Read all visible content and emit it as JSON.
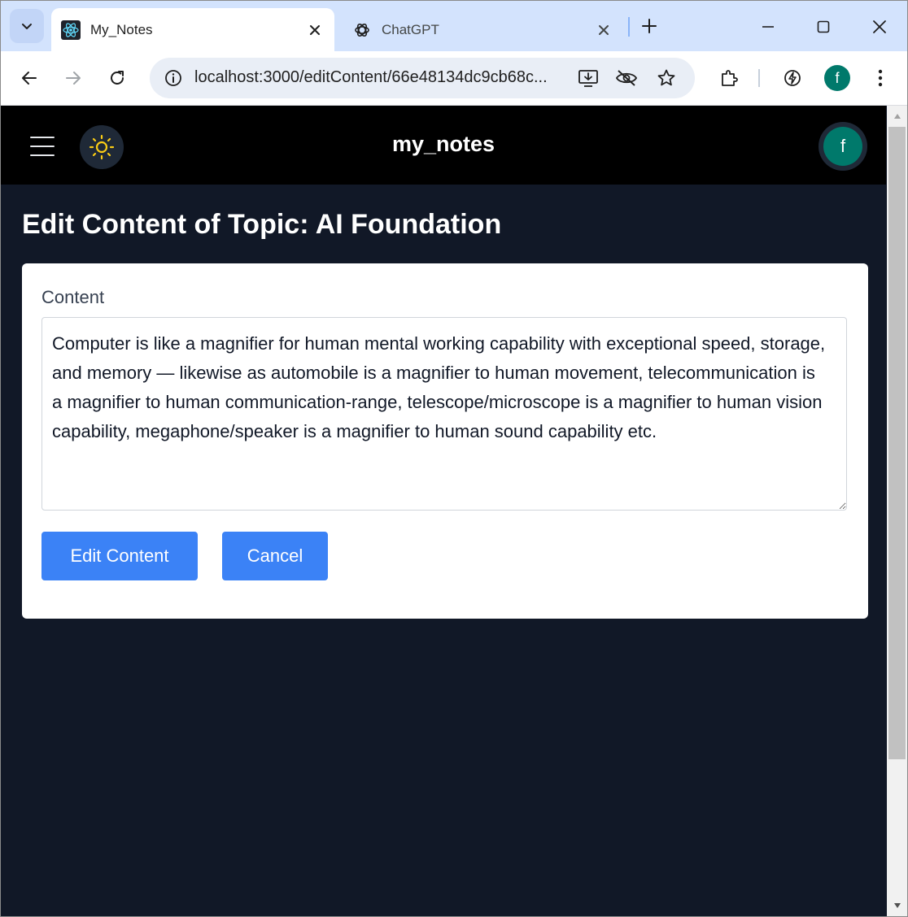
{
  "browser": {
    "tabs": [
      {
        "title": "My_Notes",
        "icon": "react-icon",
        "active": true
      },
      {
        "title": "ChatGPT",
        "icon": "chatgpt-icon",
        "active": false
      }
    ],
    "address": "localhost:3000/editContent/66e48134dc9cb68c...",
    "profile_initial": "f"
  },
  "navbar": {
    "brand": "my_notes",
    "avatar_initial": "f"
  },
  "main": {
    "page_title": "Edit Content of Topic: AI Foundation",
    "form": {
      "content_label": "Content",
      "content_value": "Computer is like a magnifier for human mental working capability with exceptional speed, storage, and memory — likewise as automobile is a magnifier to human movement, telecommunication is a magnifier to human communication-range, telescope/microscope is a magnifier to human vision capability, megaphone/speaker is a magnifier to human sound capability etc.",
      "submit_label": "Edit Content",
      "cancel_label": "Cancel"
    }
  },
  "colors": {
    "page_bg": "#111827",
    "navbar_bg": "#000000",
    "button_bg": "#3b82f6",
    "avatar_bg": "#00796b",
    "sun": "#facc15"
  }
}
